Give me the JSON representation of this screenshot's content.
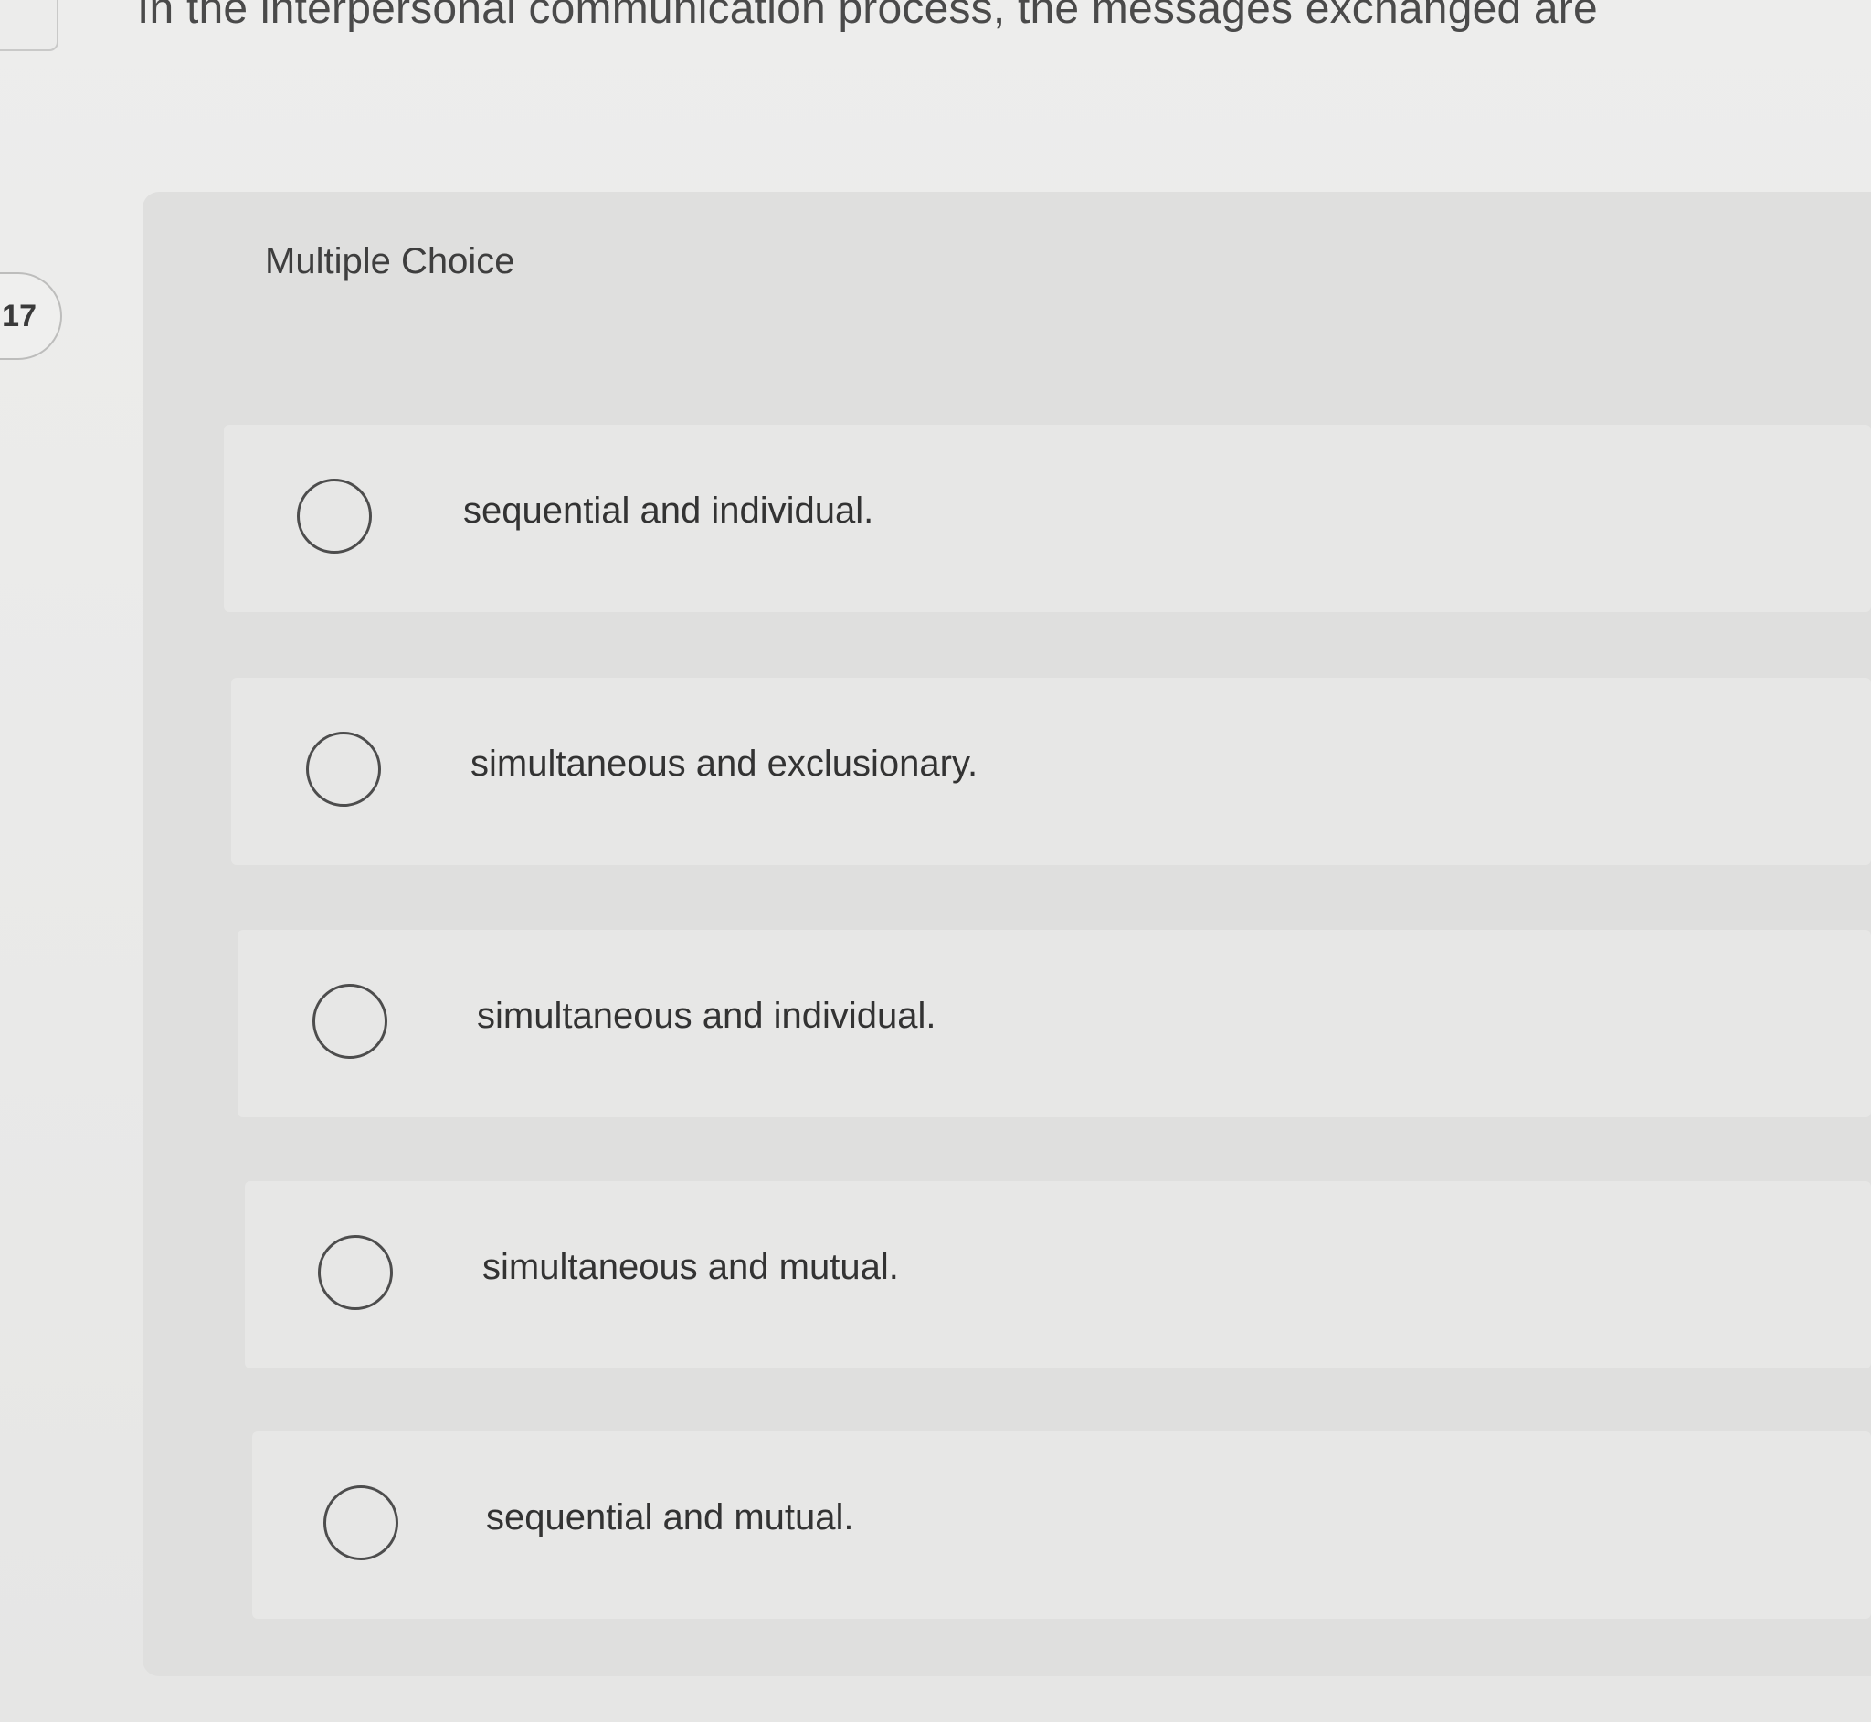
{
  "question": {
    "text": "In the interpersonal communication process, the messages exchanged are",
    "number": ":17"
  },
  "section_label": "Multiple Choice",
  "options": [
    {
      "label": "sequential and individual.",
      "selected": false
    },
    {
      "label": "simultaneous and exclusionary.",
      "selected": false
    },
    {
      "label": "simultaneous and individual.",
      "selected": false
    },
    {
      "label": "simultaneous and mutual.",
      "selected": false
    },
    {
      "label": "sequential and mutual.",
      "selected": false
    }
  ]
}
